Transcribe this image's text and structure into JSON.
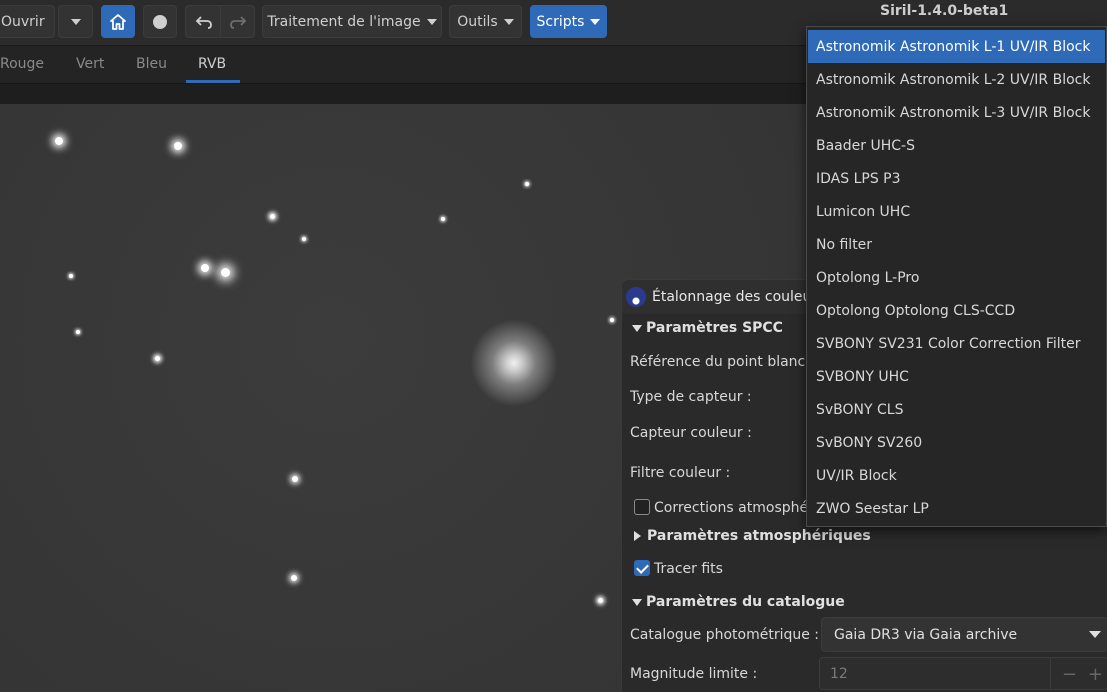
{
  "app": {
    "title": "Siril-1.4.0-beta1"
  },
  "toolbar": {
    "open_label": "Ouvrir",
    "image_processing_label": "Traitement de l'image",
    "tools_label": "Outils",
    "scripts_label": "Scripts"
  },
  "tabs": [
    {
      "label": "Rouge"
    },
    {
      "label": "Vert"
    },
    {
      "label": "Bleu"
    },
    {
      "label": "RVB"
    }
  ],
  "dialog": {
    "title": "Étalonnage des couleurs",
    "section_spcc": "Paramètres SPCC",
    "white_ref_label": "Référence du point blanc :",
    "sensor_type_label": "Type de capteur :",
    "color_sensor_label": "Capteur couleur :",
    "color_filter_label": "Filtre couleur :",
    "atmo_corrections_label": "Corrections atmosphéri",
    "section_atmo": "Paramètres atmosphériques",
    "plot_fits_label": "Tracer fits",
    "section_catalog": "Paramètres du catalogue",
    "photometric_catalog_label": "Catalogue photométrique :",
    "photometric_catalog_value": "Gaia DR3 via Gaia archive",
    "limit_magnitude_label": "Magnitude limite :",
    "limit_magnitude_value": "12"
  },
  "dropdown": {
    "items": [
      {
        "label": "Astronomik Astronomik L-1 UV/IR Block"
      },
      {
        "label": "Astronomik Astronomik L-2 UV/IR Block"
      },
      {
        "label": "Astronomik Astronomik L-3 UV/IR Block"
      },
      {
        "label": "Baader UHC-S"
      },
      {
        "label": "IDAS LPS P3"
      },
      {
        "label": "Lumicon UHC"
      },
      {
        "label": "No filter"
      },
      {
        "label": "Optolong L-Pro"
      },
      {
        "label": "Optolong Optolong CLS-CCD"
      },
      {
        "label": "SVBONY SV231 Color Correction Filter"
      },
      {
        "label": "SVBONY UHC"
      },
      {
        "label": "SvBONY CLS"
      },
      {
        "label": "SvBONY SV260"
      },
      {
        "label": "UV/IR Block"
      },
      {
        "label": "ZWO Seestar LP"
      }
    ]
  }
}
